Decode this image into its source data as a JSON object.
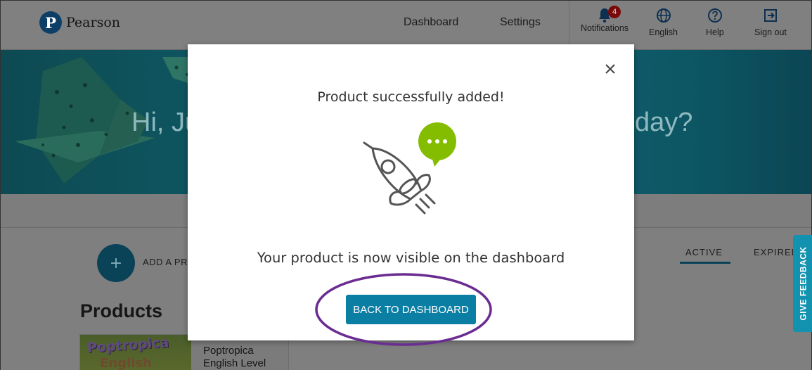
{
  "header": {
    "brand": "Pearson",
    "logo_letter": "P",
    "nav": [
      {
        "label": "Dashboard"
      },
      {
        "label": "Settings"
      }
    ],
    "icons": [
      {
        "label": "Notifications",
        "icon": "bell-icon",
        "badge": "4"
      },
      {
        "label": "English",
        "icon": "globe-icon"
      },
      {
        "label": "Help",
        "icon": "help-icon"
      },
      {
        "label": "Sign out",
        "icon": "sign-out-icon"
      }
    ]
  },
  "hero": {
    "greeting_left": "Hi, Ju",
    "greeting_right": "day?"
  },
  "main": {
    "add_icon": "+",
    "add_label": "ADD A PR",
    "products_heading": "Products",
    "tabs": [
      {
        "label": "ACTIVE",
        "selected": true
      },
      {
        "label": "EXPIRED"
      }
    ],
    "product": {
      "thumb_line1": "Poptropica",
      "thumb_line2": "English",
      "title": "Poptropica English Level"
    }
  },
  "feedback": {
    "label": "GIVE FEEDBACK"
  },
  "modal": {
    "title": "Product successfully added!",
    "message": "Your product is now visible on the dashboard",
    "button_label": "BACK TO DASHBOARD",
    "close_icon": "close-icon",
    "illustration": "rocket-icon"
  },
  "colors": {
    "primary_button": "#0b7ea3",
    "feedback_tab": "#1392b0",
    "speech_bubble": "#84bd00",
    "annotation": "#6a2c91",
    "badge": "#c8102e"
  }
}
